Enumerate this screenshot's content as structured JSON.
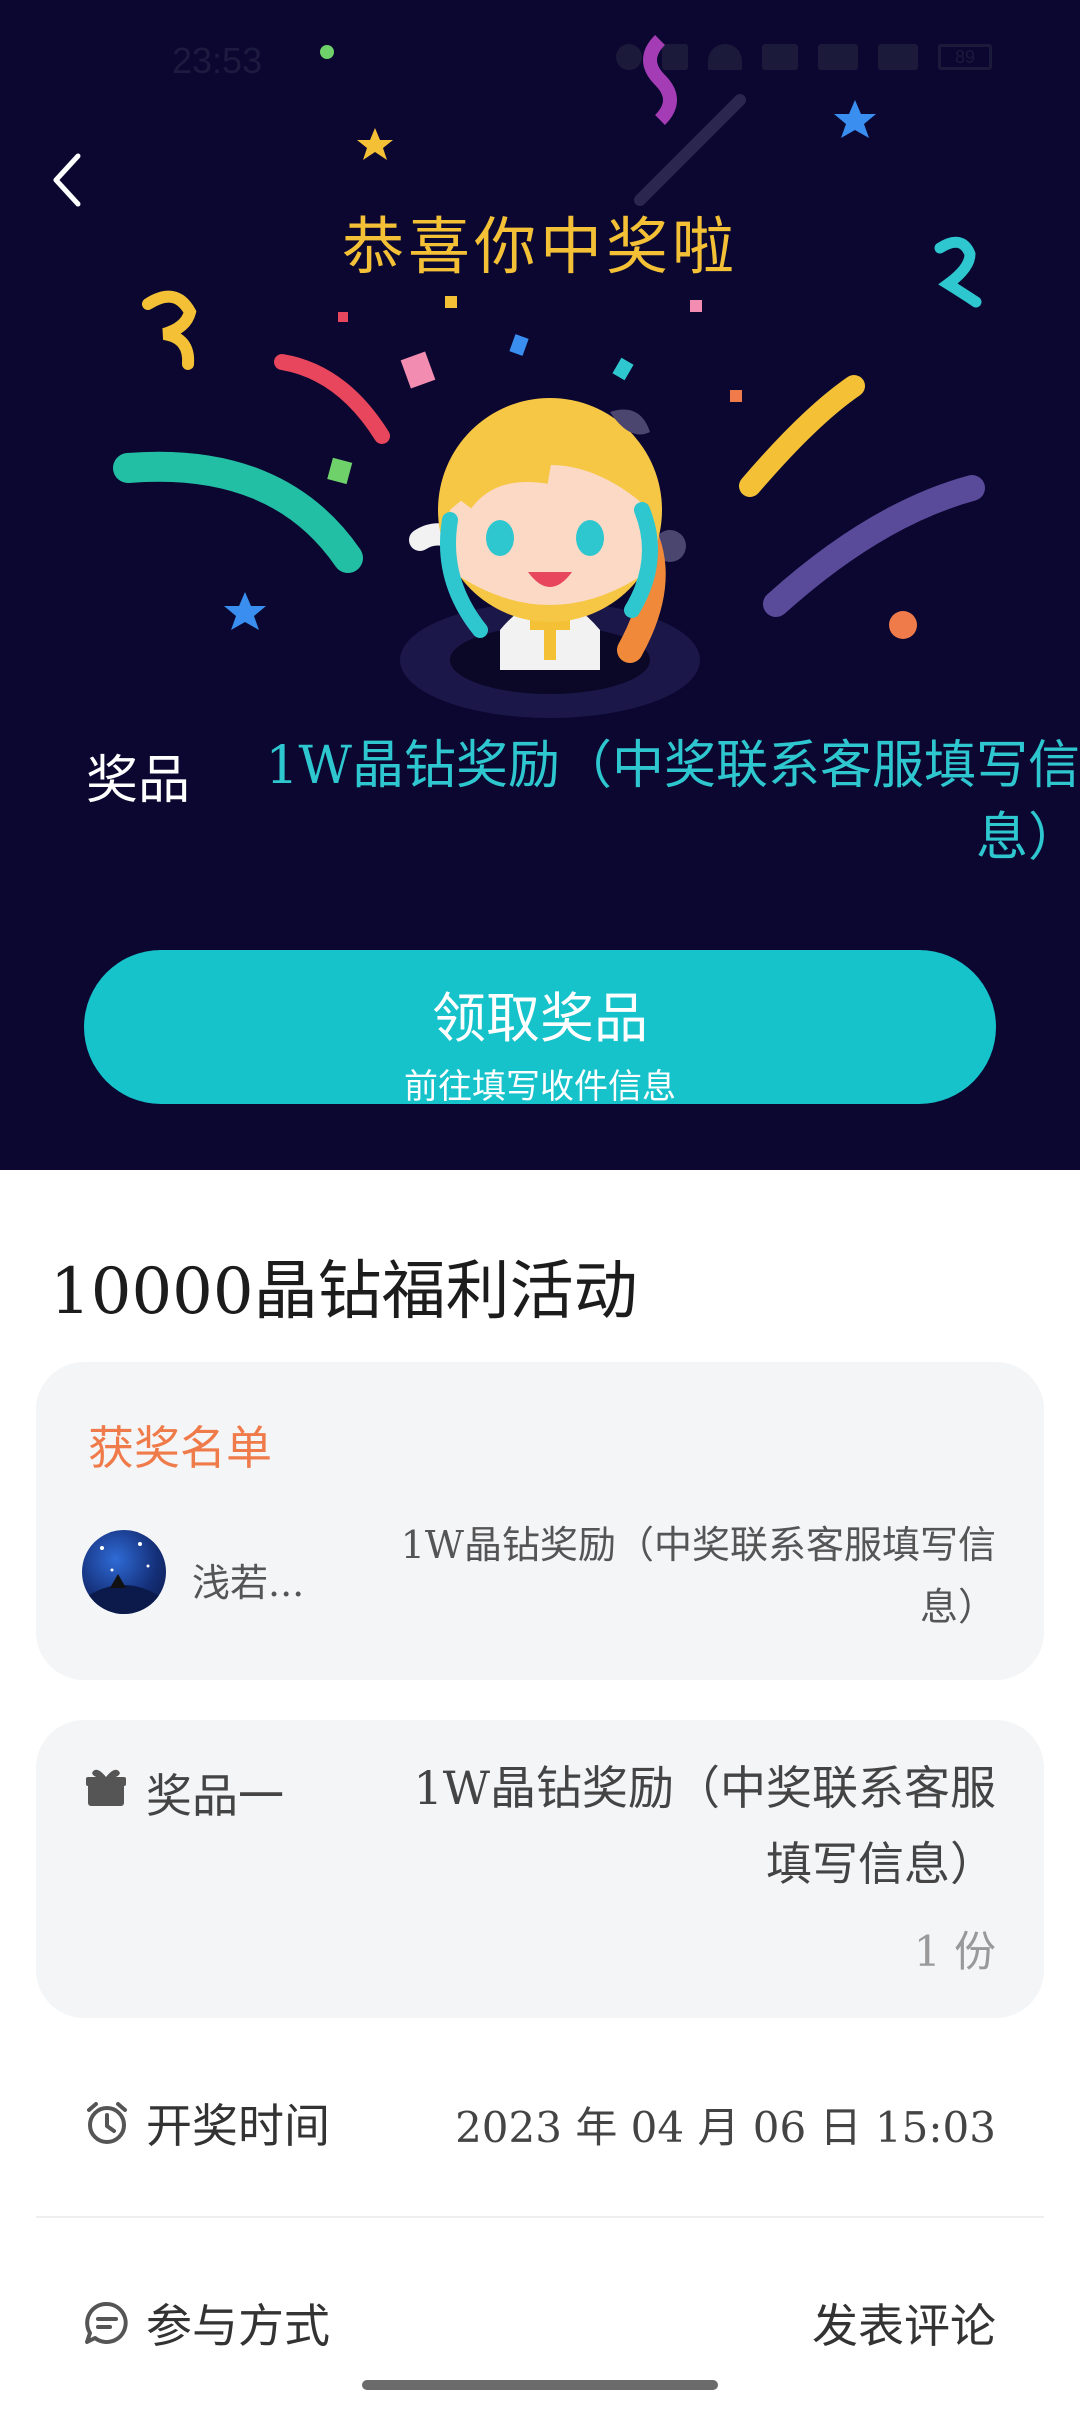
{
  "status_bar": {
    "time": "23:53",
    "battery": "89"
  },
  "header": {
    "title": "恭喜你中奖啦"
  },
  "prize": {
    "label": "奖品",
    "value": "1W晶钻奖励（中奖联系客服填写信息）"
  },
  "claim_button": {
    "label": "领取奖品",
    "sublabel": "前往填写收件信息"
  },
  "activity": {
    "title": "10000晶钻福利活动"
  },
  "winners": {
    "title": "获奖名单",
    "items": [
      {
        "name": "浅若...",
        "prize": "1W晶钻奖励（中奖联系客服填写信息）"
      }
    ]
  },
  "prize_detail": {
    "label": "奖品一",
    "value": "1W晶钻奖励（中奖联系客服填写信息）",
    "count": "1 份"
  },
  "draw_time": {
    "label": "开奖时间",
    "value": "2023 年 04 月 06 日 15:03"
  },
  "participation": {
    "label": "参与方式",
    "action": "发表评论"
  },
  "colors": {
    "hero_bg": "#0b0731",
    "title_gold": "#f4c136",
    "accent_teal": "#17c3cb",
    "winners_orange": "#f07b4a"
  }
}
